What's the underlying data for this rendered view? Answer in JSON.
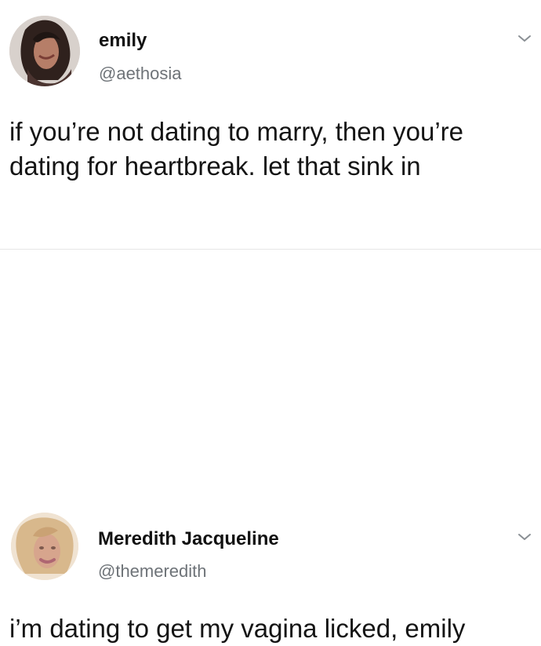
{
  "tweets": [
    {
      "name": "emily",
      "handle": "@aethosia",
      "text": "if you’re not dating to marry, then you’re dating for heartbreak. let that sink in",
      "avatar_icon": "profile-photo-icon",
      "menu_icon": "chevron-down-icon"
    },
    {
      "name": "Meredith Jacqueline",
      "handle": "@themeredith",
      "text": "i’m dating to get my vagina licked, emily",
      "avatar_icon": "profile-photo-icon",
      "menu_icon": "chevron-down-icon"
    }
  ],
  "colors": {
    "text": "#111111",
    "muted": "#6e7378",
    "divider": "#e6e6e6",
    "background": "#ffffff"
  }
}
